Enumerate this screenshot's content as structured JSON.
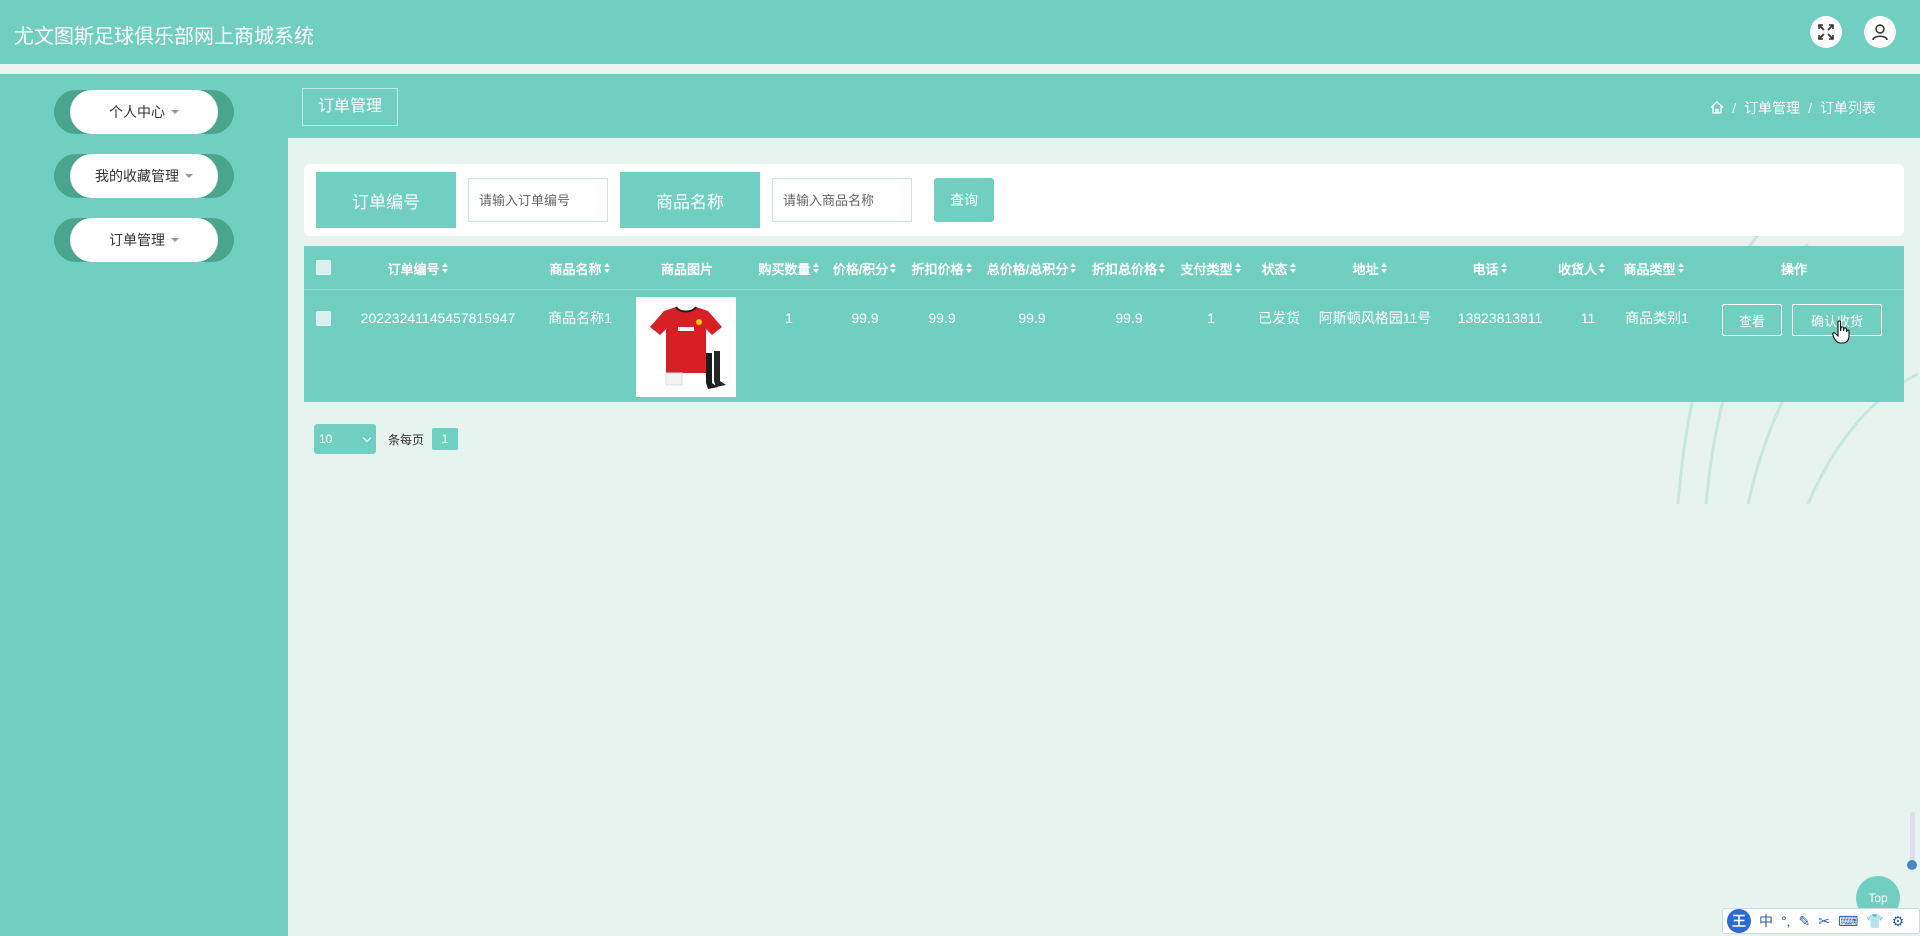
{
  "header": {
    "title": "尤文图斯足球俱乐部网上商城系统",
    "fullscreen_icon": "expand-icon",
    "user_icon": "user-icon"
  },
  "sidebar": {
    "items": [
      {
        "label": "个人中心"
      },
      {
        "label": "我的收藏管理"
      },
      {
        "label": "订单管理"
      }
    ]
  },
  "page": {
    "title": "订单管理",
    "breadcrumb": [
      "订单管理",
      "订单列表"
    ],
    "home_icon": "home-icon"
  },
  "search": {
    "order_no_label": "订单编号",
    "order_no_placeholder": "请输入订单编号",
    "product_name_label": "商品名称",
    "product_name_placeholder": "请输入商品名称",
    "query_button": "查询"
  },
  "table": {
    "columns": [
      "订单编号",
      "商品名称",
      "商品图片",
      "购买数量",
      "价格/积分",
      "折扣价格",
      "总价格/总积分",
      "折扣总价格",
      "支付类型",
      "状态",
      "地址",
      "电话",
      "收货人",
      "商品类型",
      "操作"
    ],
    "rows": [
      {
        "order_no": "20223241145457815947",
        "product_name": "商品名称1",
        "quantity": "1",
        "price": "99.9",
        "discount_price": "99.9",
        "total_price": "99.9",
        "discount_total": "99.9",
        "pay_type": "1",
        "status": "已发货",
        "address": "阿斯顿风格园11号",
        "phone": "13823813811",
        "receiver": "11",
        "product_type": "商品类别1",
        "actions": [
          "查看",
          "确认收货"
        ]
      }
    ]
  },
  "pagination": {
    "page_size": "10",
    "per_page_label": "条每页",
    "current_page": "1"
  },
  "floating": {
    "top_button": "Top",
    "ime": [
      "王",
      "中",
      "°,",
      "✎",
      "✂",
      "⌨",
      "👕",
      "⚙"
    ]
  },
  "colors": {
    "primary": "#71cfc1",
    "background": "#e6f3ee",
    "sidebar_accent": "#4aa58f"
  }
}
